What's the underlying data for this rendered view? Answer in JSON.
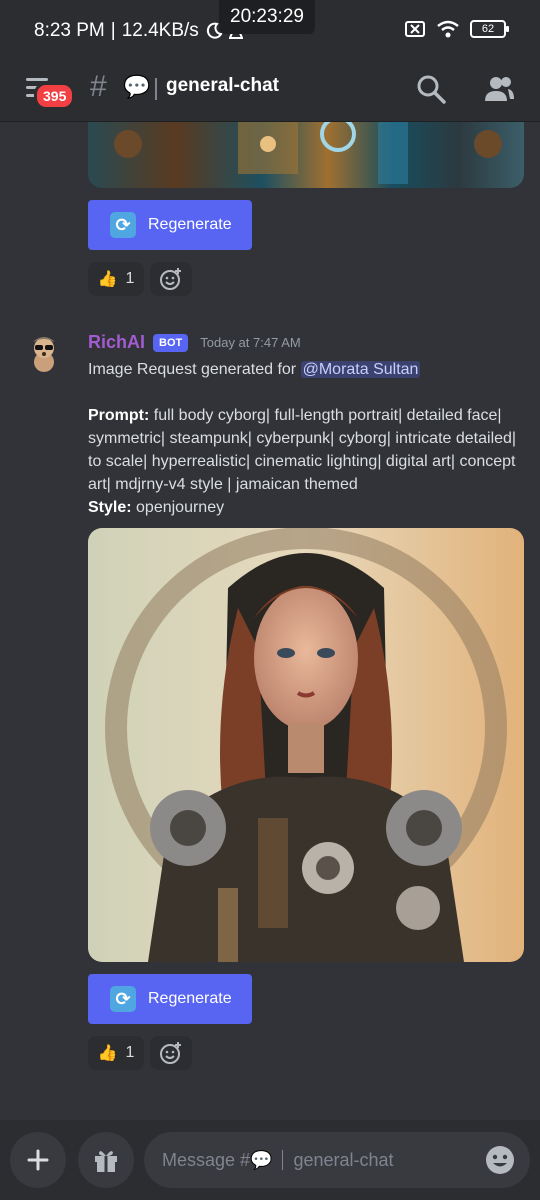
{
  "status_bar": {
    "time": "8:23 PM",
    "network_speed": "12.4KB/s",
    "clock_overlay": "20:23:29",
    "battery": "62"
  },
  "header": {
    "notification_count": "395",
    "channel_emoji": "💬",
    "channel_name": "general-chat"
  },
  "messages": [
    {
      "regenerate_label": "Regenerate",
      "reaction": {
        "emoji": "👍",
        "count": "1"
      }
    },
    {
      "author": "RichAI",
      "bot_tag": "BOT",
      "timestamp": "Today at 7:47 AM",
      "intro": "Image Request generated for",
      "mention": "@Morata Sultan",
      "prompt_label": "Prompt:",
      "prompt_text": "full body cyborg| full-length portrait| detailed face| symmetric| steampunk| cyberpunk| cyborg| intricate detailed| to scale| hyperrealistic| cinematic lighting| digital art| concept art| mdjrny-v4 style | jamaican themed",
      "style_label": "Style:",
      "style_text": "openjourney",
      "regenerate_label": "Regenerate",
      "reaction": {
        "emoji": "👍",
        "count": "1"
      }
    }
  ],
  "composer": {
    "placeholder_prefix": "Message #",
    "placeholder_emoji": "💬",
    "placeholder_channel": "general-chat"
  },
  "icons": [
    "menu-icon",
    "search-icon",
    "members-icon",
    "regenerate-icon",
    "add-reaction-icon",
    "plus-icon",
    "gift-icon",
    "emoji-icon",
    "wifi-icon",
    "moon-icon"
  ],
  "colors": {
    "background": "#313338",
    "header": "#2b2d31",
    "blurple": "#5865f2",
    "badge_red": "#f23f43",
    "author": "#a35bd0"
  }
}
